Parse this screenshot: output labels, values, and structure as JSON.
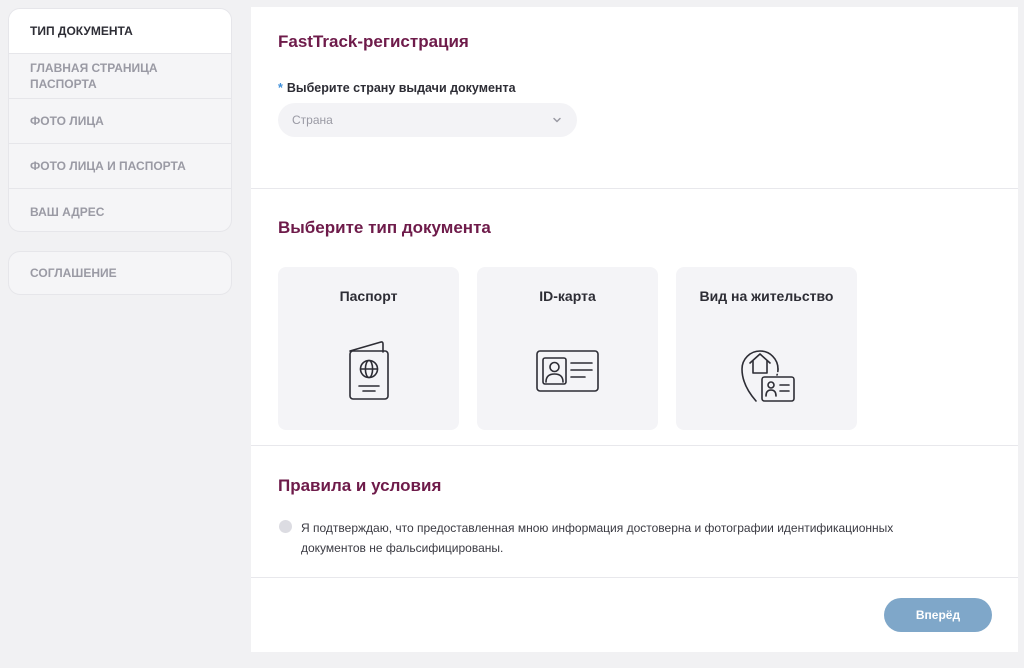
{
  "sidebar": {
    "steps": [
      {
        "label": "ТИП ДОКУМЕНТА",
        "active": true
      },
      {
        "label": "ГЛАВНАЯ СТРАНИЦА ПАСПОРТА",
        "active": false
      },
      {
        "label": "ФОТО ЛИЦА",
        "active": false
      },
      {
        "label": "ФОТО ЛИЦА И ПАСПОРТА",
        "active": false
      },
      {
        "label": "ВАШ АДРЕС",
        "active": false
      }
    ],
    "agreement": "СОГЛАШЕНИЕ"
  },
  "registration": {
    "title": "FastTrack-регистрация",
    "required_mark": "*",
    "country_label": "Выберите страну выдачи документа",
    "country_placeholder": "Страна"
  },
  "document_type": {
    "title": "Выберите тип документа",
    "cards": [
      {
        "label": "Паспорт",
        "icon": "passport-icon"
      },
      {
        "label": "ID-карта",
        "icon": "id-card-icon"
      },
      {
        "label": "Вид на жительство",
        "icon": "residence-permit-icon"
      }
    ]
  },
  "terms": {
    "title": "Правила и условия",
    "text": "Я подтверждаю, что предоставленная мною информация достоверна и фотографии идентификационных документов не фальсифицированы."
  },
  "footer": {
    "next_label": "Вперёд"
  },
  "colors": {
    "heading": "#6e1b4a",
    "accent": "#3d8ed9",
    "button": "#7fa7c9",
    "background": "#f1f1f3"
  }
}
